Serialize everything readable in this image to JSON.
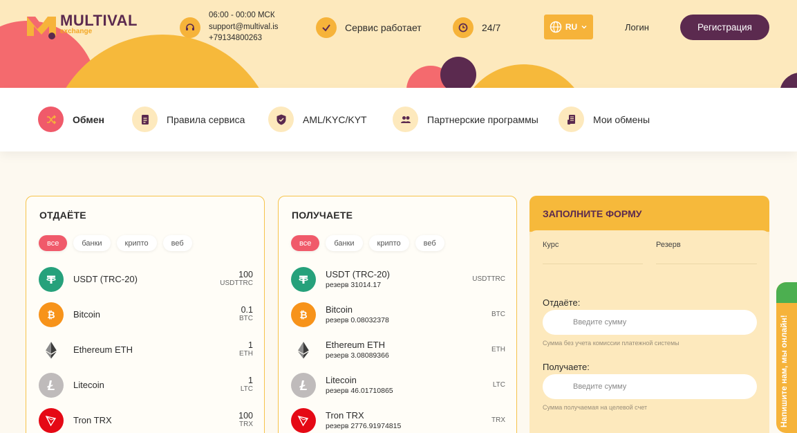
{
  "header": {
    "logo_title": "MULTIVAL",
    "logo_sub": "exchange",
    "hours": "06:00 - 00:00 МСК",
    "email": "support@multival.is",
    "phone": "+79134800263",
    "status": "Сервис работает",
    "availability": "24/7",
    "language": "RU",
    "login": "Логин",
    "register": "Регистрация"
  },
  "nav": [
    {
      "label": "Обмен",
      "icon": "shuffle-icon"
    },
    {
      "label": "Правила сервиса",
      "icon": "document-icon"
    },
    {
      "label": "AML/KYC/KYT",
      "icon": "shield-icon"
    },
    {
      "label": "Партнерские программы",
      "icon": "users-icon"
    },
    {
      "label": "Мои обмены",
      "icon": "receipt-icon"
    }
  ],
  "give": {
    "title": "ОТДАЁТЕ",
    "filters": [
      "все",
      "банки",
      "крипто",
      "веб"
    ],
    "coins": [
      {
        "name": "USDT (TRC-20)",
        "amount": "100",
        "code": "USDTTRC"
      },
      {
        "name": "Bitcoin",
        "amount": "0.1",
        "code": "BTC"
      },
      {
        "name": "Ethereum ETH",
        "amount": "1",
        "code": "ETH"
      },
      {
        "name": "Litecoin",
        "amount": "1",
        "code": "LTC"
      },
      {
        "name": "Tron TRX",
        "amount": "100",
        "code": "TRX"
      }
    ]
  },
  "receive": {
    "title": "ПОЛУЧАЕТЕ",
    "filters": [
      "все",
      "банки",
      "крипто",
      "веб"
    ],
    "coins": [
      {
        "name": "USDT (TRC-20)",
        "reserve": "резерв 31014.17",
        "code": "USDTTRC"
      },
      {
        "name": "Bitcoin",
        "reserve": "резерв 0.08032378",
        "code": "BTC"
      },
      {
        "name": "Ethereum ETH",
        "reserve": "резерв 3.08089366",
        "code": "ETH"
      },
      {
        "name": "Litecoin",
        "reserve": "резерв 46.01710865",
        "code": "LTC"
      },
      {
        "name": "Tron TRX",
        "reserve": "резерв 2776.91974815",
        "code": "TRX"
      }
    ]
  },
  "form": {
    "title": "ЗАПОЛНИТЕ ФОРМУ",
    "rate_label": "Курс",
    "reserve_label": "Резерв",
    "give_label": "Отдаёте:",
    "give_placeholder": "Введите сумму",
    "give_note": "Сумма без учета комиссии платежной системы",
    "receive_label": "Получаете:",
    "receive_placeholder": "Введите сумму",
    "receive_note": "Сумма получаемая на целевой счет"
  },
  "chat": {
    "label": "Напишите нам, мы онлайн!"
  },
  "colors": {
    "brand": "#5b2a4f",
    "accent": "#f6b33a",
    "pink": "#f05a6a"
  }
}
